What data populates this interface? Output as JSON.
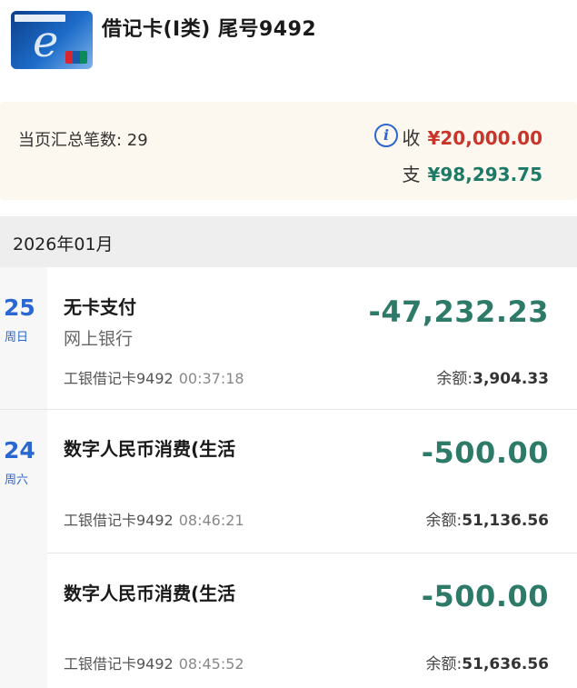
{
  "header": {
    "card_title": "借记卡(I类) 尾号9492"
  },
  "summary": {
    "count_label": "当页汇总笔数: 29",
    "income_label": "收",
    "income_amount": "¥20,000.00",
    "expense_label": "支",
    "expense_amount": "¥98,293.75"
  },
  "month": "2026年01月",
  "days": [
    {
      "day": "25",
      "weekday": "周日",
      "transactions": [
        {
          "title": "无卡支付",
          "subtitle": "网上银行",
          "amount": "-47,232.23",
          "account": "工银借记卡9492",
          "time": "00:37:18",
          "balance_label": "余额:",
          "balance": "3,904.33"
        }
      ]
    },
    {
      "day": "24",
      "weekday": "周六",
      "transactions": [
        {
          "title": "数字人民币消费(生活",
          "amount": "-500.00",
          "account": "工银借记卡9492",
          "time": "08:46:21",
          "balance_label": "余额:",
          "balance": "51,136.56"
        },
        {
          "title": "数字人民币消费(生活",
          "amount": "-500.00",
          "account": "工银借记卡9492",
          "time": "08:45:52",
          "balance_label": "余额:",
          "balance": "51,636.56"
        }
      ]
    }
  ],
  "colors": {
    "income": "#c8352b",
    "expense": "#1c7a67",
    "accent": "#2b67d1"
  },
  "icons": {
    "info": "info-icon",
    "card": "debit-card-icon"
  }
}
